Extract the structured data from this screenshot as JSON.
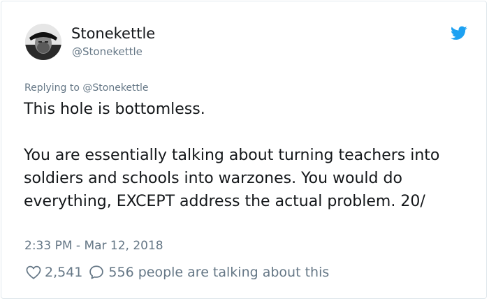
{
  "author": {
    "display_name": "Stonekettle",
    "handle": "@Stonekettle"
  },
  "reply_context": {
    "prefix": "Replying to ",
    "handle": "@Stonekettle"
  },
  "tweet": {
    "paragraphs": [
      "This hole is bottomless.",
      "You are essentially talking about turning teachers into soldiers and schools into warzones. You would do everything, EXCEPT address the actual problem. 20/"
    ],
    "timestamp": "2:33 PM - Mar 12, 2018"
  },
  "engagement": {
    "likes": "2,541",
    "conversation": "556 people are talking about this"
  },
  "colors": {
    "twitter_blue": "#1da1f2",
    "secondary_text": "#657786",
    "primary_text": "#14171a"
  },
  "icons": {
    "brand": "twitter-bird-icon",
    "like": "heart-icon",
    "reply": "speech-bubble-icon"
  }
}
